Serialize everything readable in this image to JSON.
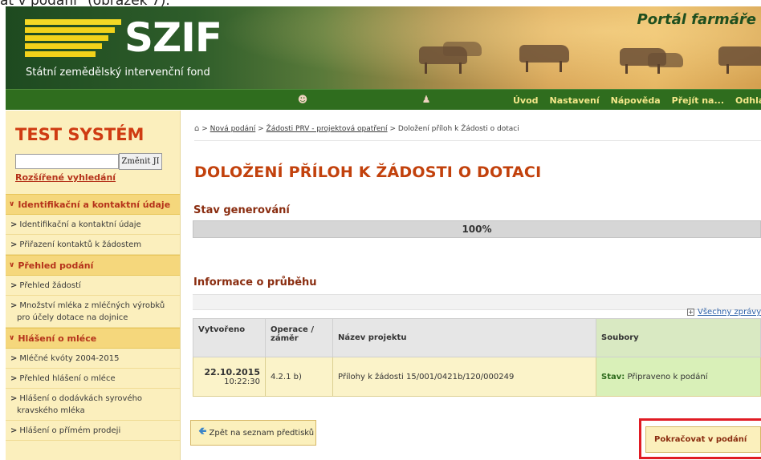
{
  "caption": "at v podání\" (obrázek 7).",
  "header": {
    "logo_text": "SZIF",
    "logo_subtitle": "Státní zemědělský intervenční fond",
    "portal_title": "Portál farmáře"
  },
  "nav": {
    "items": [
      {
        "label": "Úvod"
      },
      {
        "label": "Nastavení"
      },
      {
        "label": "Nápověda"
      },
      {
        "label": "Přejít na..."
      },
      {
        "label": "Odhlásit"
      }
    ]
  },
  "sidebar": {
    "system_title": "TEST SYSTÉM",
    "search_button": "Změnit JI",
    "search_value": "",
    "advanced_link": "Rozšířené vyhledání",
    "sections": [
      {
        "label": "Identifikační a kontaktní údaje",
        "items": [
          "Identifikační a kontaktní údaje",
          "Přiřazení kontaktů k žádostem"
        ]
      },
      {
        "label": "Přehled podání",
        "items": [
          "Přehled žádostí",
          "Množství mléka z mléčných výrobků pro účely dotace na dojnice"
        ]
      },
      {
        "label": "Hlášení o mléce",
        "items": [
          "Mléčné kvóty 2004-2015",
          "Přehled hlášení o mléce",
          "Hlášení o dodávkách syrového kravského mléka",
          "Hlášení o přímém prodeji"
        ]
      }
    ]
  },
  "breadcrumb": {
    "items": [
      "Nová podání",
      "Žádosti PRV - projektová opatření"
    ],
    "current": "Doložení příloh k Žádosti o dotaci",
    "separator": ">"
  },
  "page": {
    "title": "DOLOŽENÍ PŘÍLOH K ŽÁDOSTI O DOTACI",
    "generation_heading": "Stav generování",
    "progress_label": "100%",
    "progress_value": 1.0,
    "info_heading": "Informace o průběhu",
    "all_messages_link": "Všechny zprávy"
  },
  "table": {
    "columns": [
      "Vytvořeno",
      "Operace / záměr",
      "Název projektu",
      "Soubory"
    ],
    "rows": [
      {
        "date": "22.10.2015",
        "time": "10:22:30",
        "operation": "4.2.1 b)",
        "project": "Přílohy k žádosti 15/001/0421b/120/000249",
        "status_label": "Stav:",
        "status_value": "Připraveno k podání"
      }
    ]
  },
  "buttons": {
    "back": "Zpět na seznam předtisků",
    "continue": "Pokračovat v podání"
  },
  "colors": {
    "accent": "#c2410c",
    "nav_bg": "#2f6d1e",
    "sidebar_bg": "#fbefbd",
    "highlight_box": "#e01b24"
  }
}
